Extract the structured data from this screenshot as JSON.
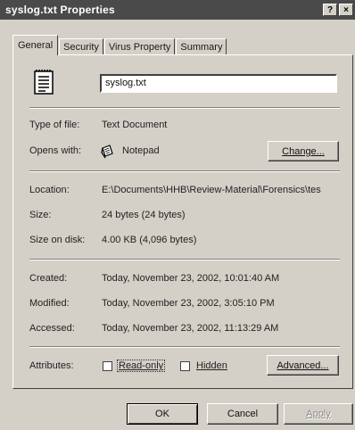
{
  "window": {
    "title": "syslog.txt Properties",
    "help_glyph": "?",
    "close_glyph": "×"
  },
  "tabs": [
    {
      "label": "General",
      "active": true
    },
    {
      "label": "Security",
      "active": false
    },
    {
      "label": "Virus Property",
      "active": false
    },
    {
      "label": "Summary",
      "active": false
    }
  ],
  "general": {
    "file_name": "syslog.txt",
    "type_label": "Type of file:",
    "type_value": "Text Document",
    "opens_label": "Opens with:",
    "opens_value": "Notepad",
    "change_button": "Change...",
    "location_label": "Location:",
    "location_value": "E:\\Documents\\HHB\\Review-Material\\Forensics\\tes",
    "size_label": "Size:",
    "size_value": "24 bytes (24 bytes)",
    "size_on_disk_label": "Size on disk:",
    "size_on_disk_value": "4.00 KB (4,096 bytes)",
    "created_label": "Created:",
    "created_value": "Today, November 23, 2002, 10:01:40 AM",
    "modified_label": "Modified:",
    "modified_value": "Today, November 23, 2002, 3:05:10 PM",
    "accessed_label": "Accessed:",
    "accessed_value": "Today, November 23, 2002, 11:13:29 AM",
    "attributes_label": "Attributes:",
    "readonly_label": "Read-only",
    "readonly_checked": false,
    "hidden_label": "Hidden",
    "hidden_checked": false,
    "advanced_button": "Advanced..."
  },
  "footer": {
    "ok_label": "OK",
    "cancel_label": "Cancel",
    "apply_label": "Apply"
  },
  "icons": [
    "text-file-icon",
    "notepad-icon",
    "help-icon",
    "close-icon"
  ]
}
